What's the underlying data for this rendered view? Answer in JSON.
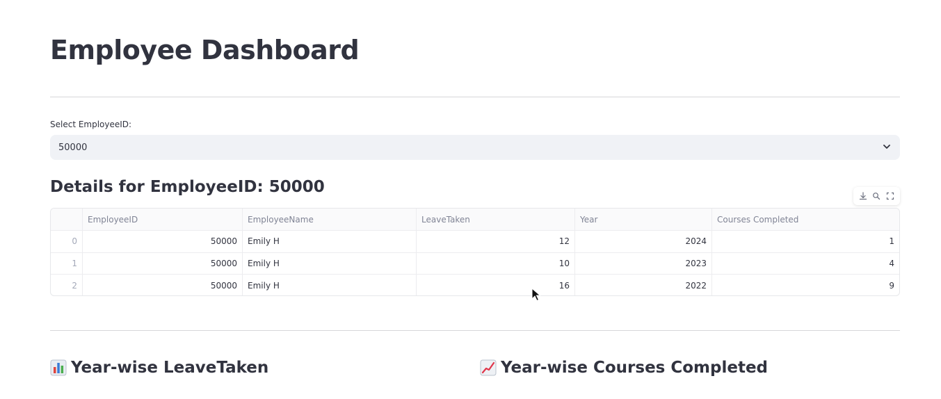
{
  "header": {
    "title": "Employee Dashboard"
  },
  "selector": {
    "label": "Select EmployeeID:",
    "value": "50000"
  },
  "details": {
    "heading": "Details for EmployeeID: 50000"
  },
  "table": {
    "columns": [
      "",
      "EmployeeID",
      "EmployeeName",
      "LeaveTaken",
      "Year",
      "Courses Completed"
    ],
    "rows": [
      {
        "index": "0",
        "employee_id": "50000",
        "employee_name": "Emily H",
        "leave_taken": "12",
        "year": "2024",
        "courses_completed": "1"
      },
      {
        "index": "1",
        "employee_id": "50000",
        "employee_name": "Emily H",
        "leave_taken": "10",
        "year": "2023",
        "courses_completed": "4"
      },
      {
        "index": "2",
        "employee_id": "50000",
        "employee_name": "Emily H",
        "leave_taken": "16",
        "year": "2022",
        "courses_completed": "9"
      }
    ]
  },
  "charts": {
    "left_heading": "Year-wise LeaveTaken",
    "left_icon": "bar-chart-icon",
    "right_heading": "Year-wise Courses Completed",
    "right_icon": "chart-increasing-icon"
  },
  "toolbar": {
    "icons": [
      "download-icon",
      "search-icon",
      "fullscreen-icon"
    ]
  },
  "colors": {
    "text": "#31333f",
    "select_bg": "#f0f2f6",
    "muted": "#808495"
  }
}
